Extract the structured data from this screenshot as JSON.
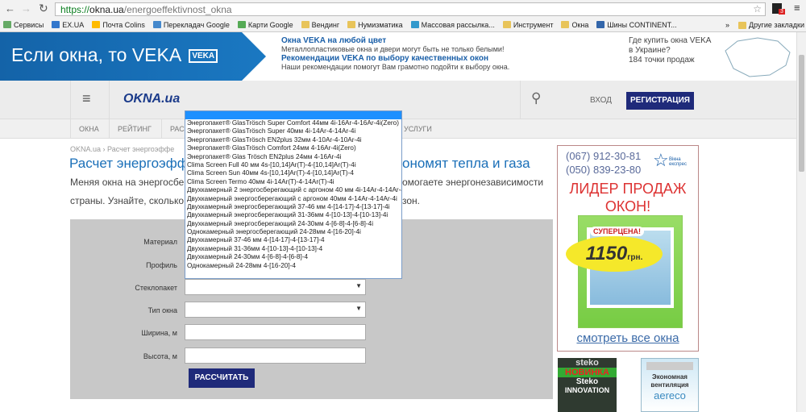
{
  "browser": {
    "url_scheme": "https://",
    "url_host": "okna.ua",
    "url_path": "/energoeffektivnost_okna",
    "extension_badge": "3",
    "bookmarks": [
      "Сервисы",
      "EX.UA",
      "Почта Colins",
      "Перекладач Google",
      "Карти Google",
      "Вендинг",
      "Нумизматика",
      "Массовая рассылка...",
      "Инструмент",
      "Окна",
      "Шины CONTINENT..."
    ],
    "more_bookmarks": "Другие закладки"
  },
  "banner": {
    "slogan": "Если окна, то VEKA",
    "logo": "VEKA",
    "link1": "Окна VEKA на любой цвет",
    "text1": "Металлопластиковые окна и двери могут быть не только белыми!",
    "link2": "Рекомендации VEKA по выбору качественных окон",
    "text2": "Наши рекомендации помогут Вам грамотно подойти к выбору окна.",
    "where": "Где купить окна VEKA",
    "where2": "в Украине?",
    "points": "184 точки продаж"
  },
  "header": {
    "logo": "OKNA.ua",
    "login": "ВХОД",
    "register": "РЕГИСТРАЦИЯ"
  },
  "nav": [
    "ОКНА",
    "РЕЙТИНГ",
    "РАС",
    "УСЛУГИ"
  ],
  "breadcrumb": "OKNA.ua › Расчет энергоэффе",
  "title_left": "Расчет энергоэффект",
  "title_right": "ономят тепла и газа",
  "intro_left1": "Меняя окна на энергосбере",
  "intro_right1": "омогаете энергонезависимости",
  "intro_left2": "страны. Узнайте, сколько ва",
  "intro_right2": "зон.",
  "form": {
    "labels": [
      "Материал",
      "Профиль",
      "Стеклопакет",
      "Тип окна",
      "Ширина, м",
      "Высота, м"
    ],
    "submit": "РАССЧИТАТЬ"
  },
  "dropdown_options": [
    "",
    "Энергопакет® GlasTrösch Super Comfort 44мм 4i-16Ar-4-16Ar-4i(Zero)",
    "Энергопакет® GlasTrösch Super 40мм 4i-14Ar-4-14Ar-4i",
    "Энергопакет® GlasTrösch EN2plus 32мм 4-10Ar-4-10Ar-4i",
    "Энергопакет® GlasTrösch Comfort 24мм 4-16Ar-4i(Zero)",
    "Энергопакет® Glas Trösch EN2plus 24мм 4-16Ar-4i",
    "Clima Screen Full 40 мм 4s-[10,14]Ar(T)-4-[10,14]Ar(T)-4i",
    "Clima Screen Sun 40мм 4s-[10,14]Ar(T)-4-[10,14]Ar(T)-4",
    "Clima Screen Termo 40мм 4i-14Ar(T)-4-14Ar(T)-4i",
    "Двухкамерный 2 энергосберегающий с аргоном 40 мм 4i-14Ar-4-14Ar-4i",
    "Двухкамерный энергосберегающий с аргоном 40мм 4-14Ar-4-14Ar-4i",
    "Двухкамерный энергосберегающий 37-46 мм 4-[14-17]-4-[13-17]-4i",
    "Двухкамерный энергосберегающий 31-36мм 4-[10-13]-4-[10-13]-4i",
    "Двухкамерный энергосберегающий 24-30мм 4-[6-8]-4-[6-8]-4i",
    "Однокамерный энергосберегающий 24-28мм 4-[16-20]-4i",
    "Двухкамерный 37-46 мм 4-[14-17]-4-[13-17]-4",
    "Двухкамерный 31-36мм 4-[10-13]-4-[10-13]-4",
    "Двухкамерный 24-30мм 4-[6-8]-4-[6-8]-4",
    "Однокамерный 24-28мм 4-[16-20]-4"
  ],
  "ad": {
    "phone1": "(067) 912-30-81",
    "phone2": "(050) 839-23-80",
    "brand": "Вікна експрес",
    "headline1": "ЛИДЕР ПРОДАЖ",
    "headline2": "ОКОН!",
    "promo": "СУПЕРЦЕНА!",
    "price": "1150",
    "currency": "грн.",
    "link": "смотреть все окна"
  },
  "ad2": {
    "brand": "steko",
    "new": "НОВИНКА",
    "name1": "Steko",
    "name2": "INNOVATION"
  },
  "ad3": {
    "text1": "Экономная",
    "text2": "вентиляция",
    "brand": "aereco"
  }
}
